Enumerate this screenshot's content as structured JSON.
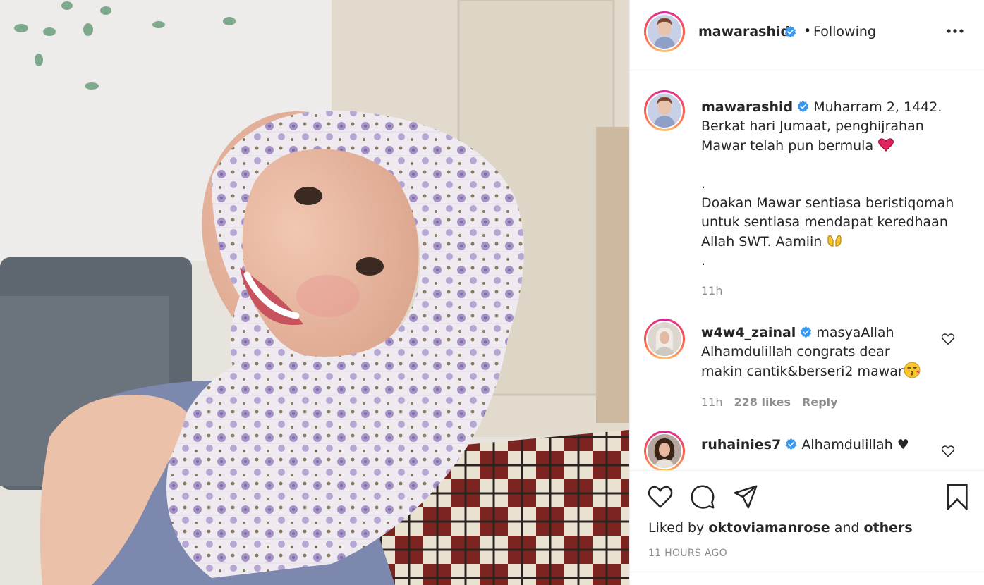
{
  "post": {
    "author": "mawarashid",
    "follow_state": "Following",
    "separator": "•",
    "caption_lines": [
      "Muharram 2, 1442.",
      "Berkat hari Jumaat, penghijrahan",
      "Mawar telah pun bermula",
      ".",
      "Doakan Mawar sentiasa beristiqomah",
      "untuk sentiasa mendapat keredhaan",
      "Allah SWT. Aamiin",
      "."
    ],
    "caption_time": "11h",
    "liked_by_prefix": "Liked by",
    "liked_by_user": "oktoviamanrose",
    "liked_by_and": "and",
    "liked_by_others": "others",
    "posted_ago": "11 HOURS AGO"
  },
  "comments": [
    {
      "user": "w4w4_zainal",
      "lines": [
        "masyaAllah",
        "Alhamdulillah congrats dear",
        "makin cantik&berseri2 mawar"
      ],
      "time": "11h",
      "likes": "228 likes",
      "reply": "Reply"
    },
    {
      "user": "ruhainies7",
      "lines": [
        "Alhamdulillah ♥"
      ]
    }
  ],
  "icons": {
    "verified": "verified-badge-icon",
    "more": "more-options-icon",
    "like": "heart-icon",
    "comment": "comment-icon",
    "share": "share-icon",
    "save": "bookmark-icon"
  },
  "colors": {
    "verified": "#3897f0",
    "text": "#262626",
    "muted": "#8e8e8e",
    "heart_emoji": "#e0245e",
    "border": "#efefef"
  }
}
